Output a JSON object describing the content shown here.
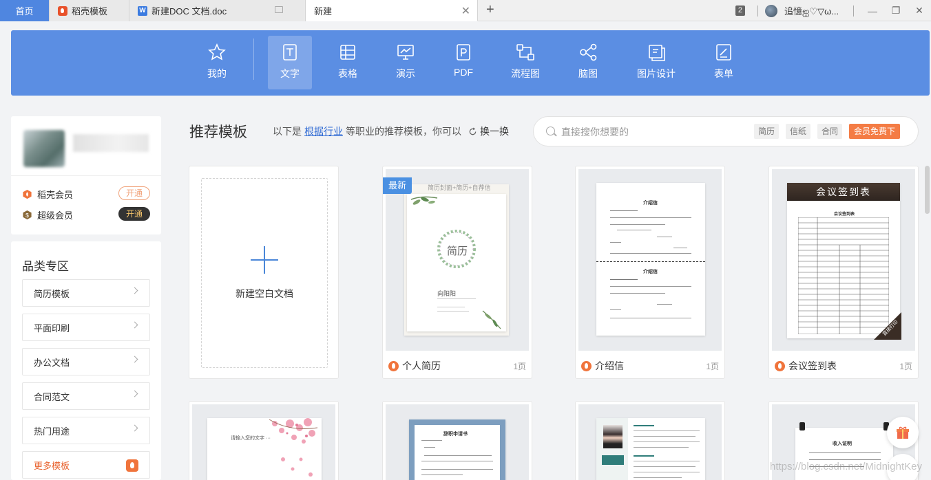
{
  "tabs": {
    "home": "首页",
    "t1": "稻壳模板",
    "t2": "新建DOC 文档.doc",
    "t3": "新建",
    "count_badge": "2",
    "username": "追憶ஐ♡▽ω..."
  },
  "appnav": [
    {
      "label": "我的",
      "icon": "star-icon",
      "active": false
    },
    {
      "label": "文字",
      "icon": "writer-doc-icon",
      "active": true
    },
    {
      "label": "表格",
      "icon": "spreadsheet-icon",
      "active": false
    },
    {
      "label": "演示",
      "icon": "presentation-icon",
      "active": false
    },
    {
      "label": "PDF",
      "icon": "pdf-icon",
      "active": false
    },
    {
      "label": "流程图",
      "icon": "flowchart-icon",
      "active": false
    },
    {
      "label": "脑图",
      "icon": "mindmap-icon",
      "active": false
    },
    {
      "label": "图片设计",
      "icon": "image-design-icon",
      "active": false
    },
    {
      "label": "表单",
      "icon": "form-icon",
      "active": false
    }
  ],
  "membership": {
    "docer_vip": "稻壳会员",
    "super_vip": "超级会员",
    "open_label": "开通"
  },
  "categories": {
    "title": "品类专区",
    "items": [
      "简历模板",
      "平面印刷",
      "办公文档",
      "合同范文",
      "热门用途"
    ],
    "more": "更多模板"
  },
  "main": {
    "title": "推荐模板",
    "hint_prefix": "以下是",
    "hint_link": "根据行业",
    "hint_suffix": "等职业的推荐模板，你可以",
    "refresh": "换一换"
  },
  "search": {
    "placeholder": "直接搜你想要的",
    "tags": [
      "简历",
      "信纸",
      "合同"
    ],
    "free_label": "会员免费下"
  },
  "new_blank": "新建空白文档",
  "templates": [
    {
      "name": "个人简历",
      "pages": "1页",
      "badge": "最新",
      "banner": "简历封面+简历+自荐信",
      "cover_title": "简历",
      "person": "向阳阳"
    },
    {
      "name": "介绍信",
      "pages": "1页",
      "heading1": "介绍信",
      "heading2": "介绍信"
    },
    {
      "name": "会议签到表",
      "pages": "1页",
      "banner": "会议签到表",
      "sub": "会议签到表",
      "corner": "直接打印"
    }
  ],
  "row2": {
    "c1_text": "请输入您的文字 ···",
    "c2_title": "辞职申请书",
    "c4_title": "收入证明"
  },
  "watermark": "https://blog.csdn.net/MidnightKey"
}
